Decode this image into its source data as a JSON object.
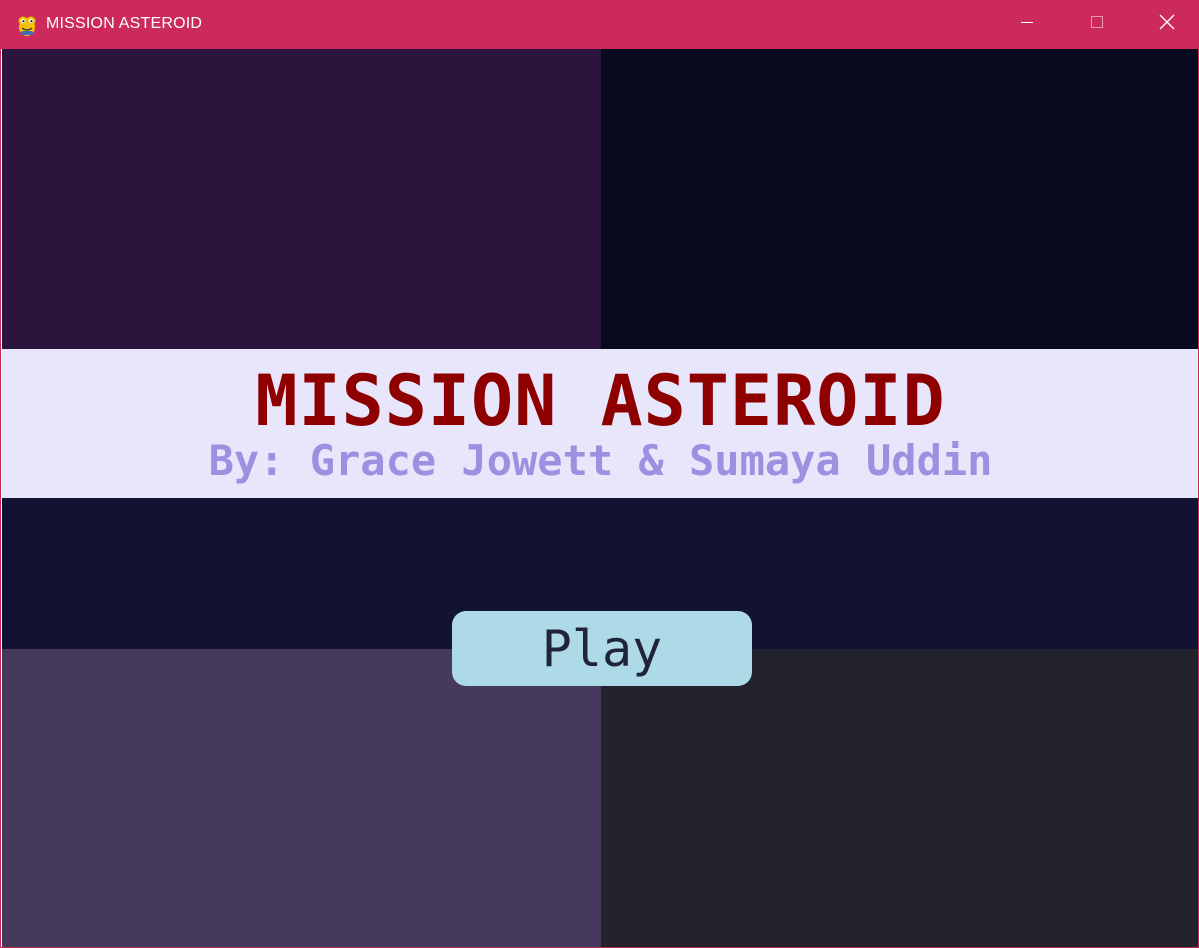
{
  "window": {
    "title": "MISSION ASTEROID",
    "app_icon": "pygame-snake-icon",
    "controls": {
      "minimize_icon": "minimize-icon",
      "maximize_icon": "maximize-icon",
      "close_icon": "close-icon"
    }
  },
  "colors": {
    "titlebar": "#cc295c",
    "quadrant_top_left": "#2b153c",
    "quadrant_top_right": "#070a1e",
    "banner": "#e8e6fb",
    "middle_band": "#121233",
    "quadrant_bottom_left": "#463a5c",
    "quadrant_bottom_right": "#23232e",
    "title_text": "#8e0000",
    "credits_text": "#a08fe0",
    "play_button_bg": "#aed9e6",
    "play_button_text": "#20243a"
  },
  "menu": {
    "game_title": "MISSION ASTEROID",
    "credits": "By: Grace Jowett & Sumaya Uddin",
    "play_label": "Play"
  }
}
